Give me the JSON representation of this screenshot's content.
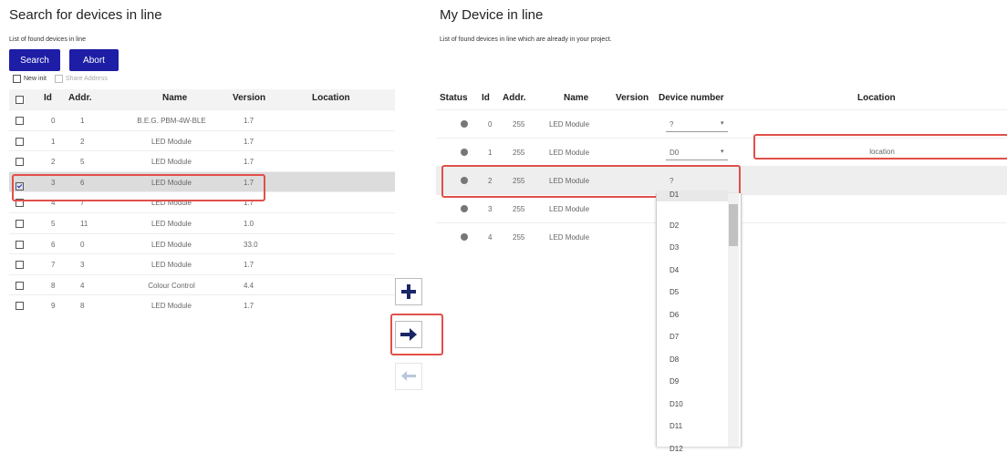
{
  "left": {
    "title": "Search for devices in line",
    "subtitle": "List of found devices in line",
    "search_label": "Search",
    "abort_label": "Abort",
    "new_init_label": "New init",
    "share_address_label": "Share Address",
    "columns": [
      "Id",
      "Addr.",
      "Name",
      "Version",
      "Location"
    ],
    "rows": [
      {
        "id": "0",
        "addr": "1",
        "name": "B.E.G. PBM-4W-BLE",
        "version": "1.7",
        "checked": false
      },
      {
        "id": "1",
        "addr": "2",
        "name": "LED Module",
        "version": "1.7",
        "checked": false
      },
      {
        "id": "2",
        "addr": "5",
        "name": "LED Module",
        "version": "1.7",
        "checked": false
      },
      {
        "id": "3",
        "addr": "6",
        "name": "LED Module",
        "version": "1.7",
        "checked": true
      },
      {
        "id": "4",
        "addr": "7",
        "name": "LED Module",
        "version": "1.7",
        "checked": false
      },
      {
        "id": "5",
        "addr": "11",
        "name": "LED Module",
        "version": "1.0",
        "checked": false
      },
      {
        "id": "6",
        "addr": "0",
        "name": "LED Module",
        "version": "33.0",
        "checked": false
      },
      {
        "id": "7",
        "addr": "3",
        "name": "LED Module",
        "version": "1.7",
        "checked": false
      },
      {
        "id": "8",
        "addr": "4",
        "name": "Colour Control",
        "version": "4.4",
        "checked": false
      },
      {
        "id": "9",
        "addr": "8",
        "name": "LED Module",
        "version": "1.7",
        "checked": false
      }
    ]
  },
  "middle": {
    "add_icon": "plus-icon",
    "move_icon": "arrow-right-icon",
    "back_icon": "arrow-left-icon"
  },
  "right": {
    "title": "My Device in line",
    "subtitle": "List of found devices in line which are already in your project.",
    "columns": [
      "Status",
      "Id",
      "Addr.",
      "Name",
      "Version",
      "Device number",
      "Location"
    ],
    "rows": [
      {
        "id": "0",
        "addr": "255",
        "name": "LED Module",
        "device_number": "?",
        "location": ""
      },
      {
        "id": "1",
        "addr": "255",
        "name": "LED Module",
        "device_number": "D0",
        "location": "location"
      },
      {
        "id": "2",
        "addr": "255",
        "name": "LED Module",
        "device_number": "?",
        "location": ""
      },
      {
        "id": "3",
        "addr": "255",
        "name": "LED Module",
        "device_number": "",
        "location": ""
      },
      {
        "id": "4",
        "addr": "255",
        "name": "LED Module",
        "device_number": "",
        "location": ""
      }
    ],
    "dropdown_options": [
      "D1",
      "D2",
      "D3",
      "D4",
      "D5",
      "D6",
      "D7",
      "D8",
      "D9",
      "D10",
      "D11",
      "D12"
    ]
  },
  "colors": {
    "button_blue": "#1d1da6",
    "highlight_red": "#e0504a",
    "selected_row": "#dcdcdc",
    "status_dot": "#777777"
  }
}
